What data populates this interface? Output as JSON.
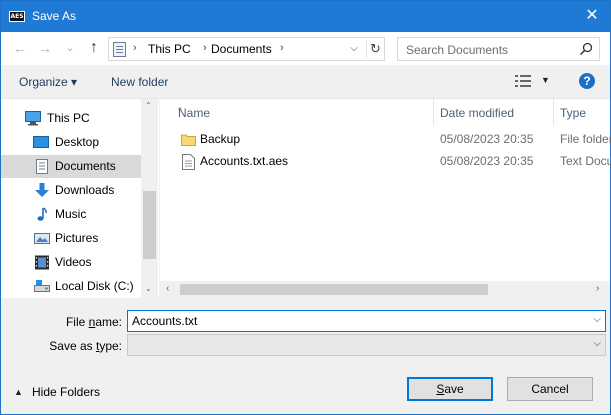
{
  "window": {
    "title": "Save As",
    "app_badge": "AES",
    "close_glyph": "✕",
    "accent": "#1f7ad6"
  },
  "nav": {
    "back_glyph": "←",
    "forward_glyph": "→",
    "recent_glyph": "⌄",
    "up_glyph": "↑",
    "breadcrumb": [
      "This PC",
      "Documents"
    ],
    "search_placeholder": "Search Documents"
  },
  "toolbar": {
    "organize": "Organize ▾",
    "new_folder": "New folder",
    "help": "?"
  },
  "tree": {
    "items": [
      {
        "label": "This PC",
        "icon": "computer-icon"
      },
      {
        "label": "Desktop",
        "icon": "desktop-icon"
      },
      {
        "label": "Documents",
        "icon": "documents-icon",
        "selected": true
      },
      {
        "label": "Downloads",
        "icon": "downloads-icon"
      },
      {
        "label": "Music",
        "icon": "music-icon"
      },
      {
        "label": "Pictures",
        "icon": "pictures-icon"
      },
      {
        "label": "Videos",
        "icon": "videos-icon"
      },
      {
        "label": "Local Disk (C:)",
        "icon": "drive-icon"
      }
    ]
  },
  "files": {
    "columns": [
      "Name",
      "Date modified",
      "Type"
    ],
    "rows": [
      {
        "name": "Backup",
        "date": "05/08/2023 20:35",
        "type": "File folder",
        "icon": "folder-icon"
      },
      {
        "name": "Accounts.txt.aes",
        "date": "05/08/2023 20:35",
        "type": "Text Document",
        "icon": "document-icon"
      }
    ]
  },
  "form": {
    "file_name_label_pre": "File ",
    "file_name_label_u": "n",
    "file_name_label_post": "ame:",
    "file_name_value": "Accounts.txt",
    "save_type_label_pre": "Save as ",
    "save_type_label_u": "t",
    "save_type_label_post": "ype:",
    "save_type_value": ""
  },
  "footer": {
    "hide_folders": "Hide Folders",
    "save_pre": "",
    "save_u": "S",
    "save_post": "ave",
    "cancel": "Cancel"
  }
}
